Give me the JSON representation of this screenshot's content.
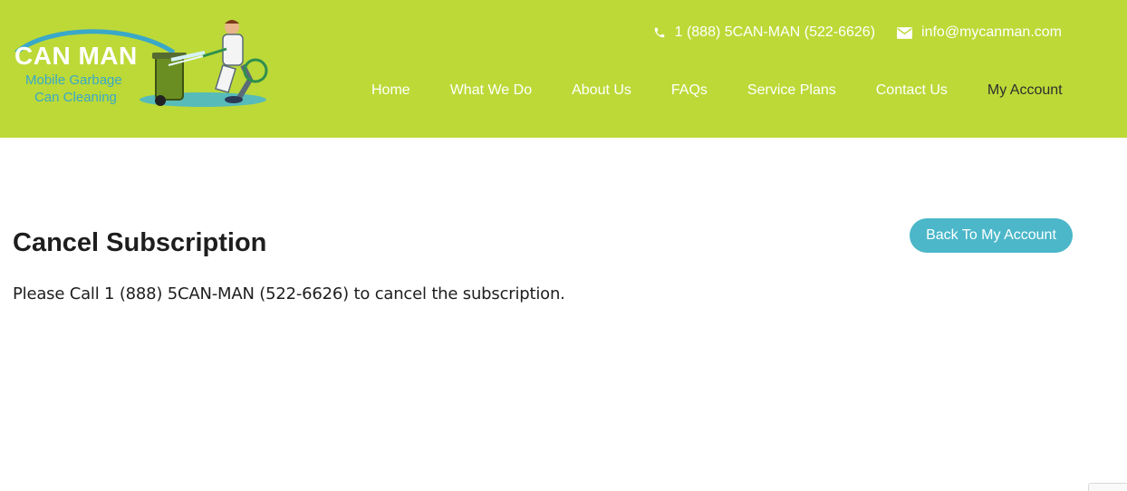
{
  "colors": {
    "brand": "#bcd937",
    "accent": "#4bb7c9",
    "text": "#1e1e1e"
  },
  "logo": {
    "line1": "CAN MAN",
    "line2": "Mobile Garbage",
    "line3": "Can Cleaning"
  },
  "contact": {
    "phone_icon": "phone-icon",
    "phone": "1 (888) 5CAN-MAN (522-6626)",
    "email_icon": "envelope-icon",
    "email": "info@mycanman.com"
  },
  "nav": {
    "items": [
      {
        "label": "Home"
      },
      {
        "label": "What We Do"
      },
      {
        "label": "About Us"
      },
      {
        "label": "FAQs"
      },
      {
        "label": "Service Plans"
      },
      {
        "label": "Contact Us"
      },
      {
        "label": "My Account"
      }
    ],
    "active": "My Account"
  },
  "main": {
    "title": "Cancel Subscription",
    "message": "Please Call 1 (888) 5CAN-MAN (522-6626) to cancel the subscription.",
    "back_button": "Back To My Account"
  }
}
